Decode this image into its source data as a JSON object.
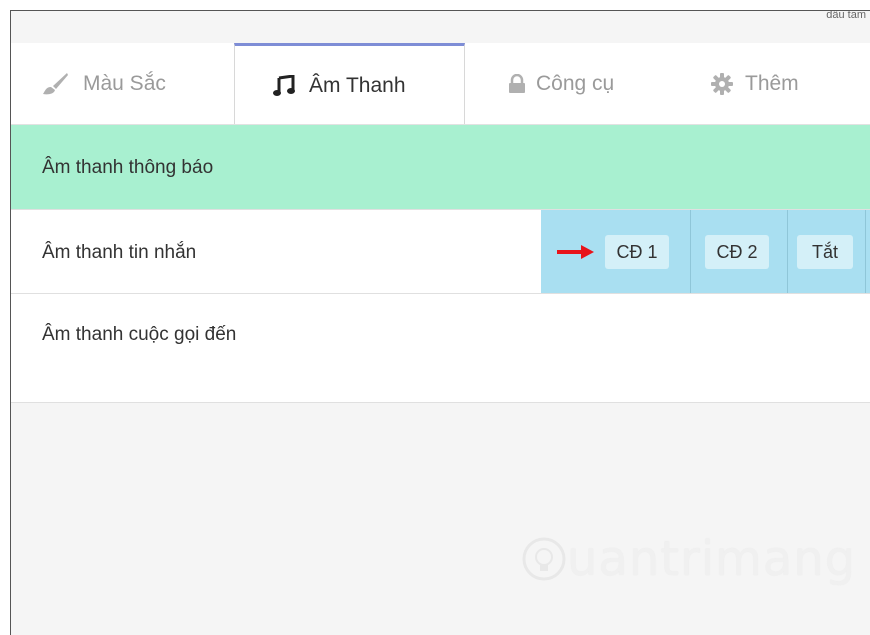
{
  "top": {
    "cut_text": "dấu tam"
  },
  "tabs": [
    {
      "label": "Màu Sắc",
      "icon": "paintbrush-icon",
      "active": false
    },
    {
      "label": "Âm Thanh",
      "icon": "music-note-icon",
      "active": true
    },
    {
      "label": "Công cụ",
      "icon": "lock-icon",
      "active": false
    },
    {
      "label": "Thêm",
      "icon": "gear-icon",
      "active": false
    }
  ],
  "settings": {
    "notify_label": "Âm thanh thông báo",
    "message_label": "Âm thanh tin nhắn",
    "message_options": [
      "CĐ 1",
      "CĐ 2",
      "Tắt"
    ],
    "call_label": "Âm thanh cuộc gọi đến"
  },
  "colors": {
    "accent": "#7e8dd6",
    "notify_bg": "#a8f0d0",
    "options_bg": "#a9dff1",
    "arrow": "#e8141a"
  },
  "watermark": {
    "text": "uantrimang"
  }
}
